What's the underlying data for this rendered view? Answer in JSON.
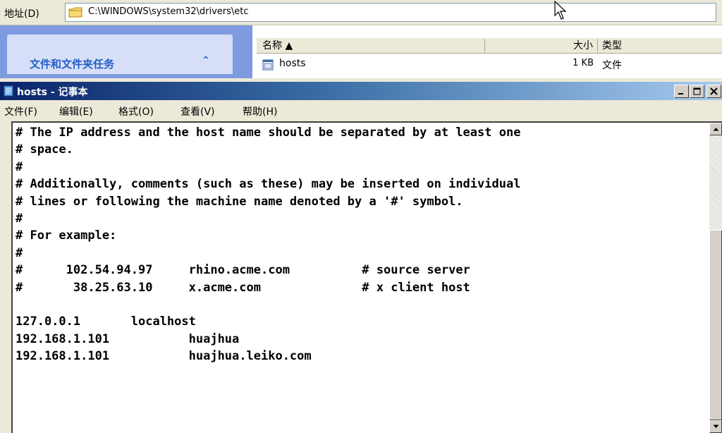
{
  "address_bar": {
    "label": "地址(D)",
    "path": "C:\\WINDOWS\\system32\\drivers\\etc"
  },
  "task_panel": {
    "title": "文件和文件夹任务",
    "collapse_glyph": "⌃"
  },
  "file_list": {
    "columns": {
      "name": "名称 ▲",
      "size": "大小",
      "type": "类型"
    },
    "rows": [
      {
        "name": "hosts",
        "size": "1 KB",
        "type": "文件",
        "icon": "hosts-file-icon"
      }
    ]
  },
  "notepad": {
    "title": "hosts - 记事本",
    "menu": {
      "file": "文件(F)",
      "edit": "编辑(E)",
      "format": "格式(O)",
      "view": "查看(V)",
      "help": "帮助(H)"
    },
    "content": "# The IP address and the host name should be separated by at least one\n# space.\n#\n# Additionally, comments (such as these) may be inserted on individual\n# lines or following the machine name denoted by a '#' symbol.\n#\n# For example:\n#\n#      102.54.94.97     rhino.acme.com          # source server\n#       38.25.63.10     x.acme.com              # x client host\n\n127.0.0.1       localhost\n192.168.1.101           huajhua\n192.168.1.101           huajhua.leiko.com"
  },
  "colors": {
    "titlebar_start": "#0a246a",
    "titlebar_end": "#a6caf0",
    "task_panel_bg": "#7f9be0",
    "task_title": "#215dc6",
    "window_face": "#ece9d8"
  },
  "icons": [
    "folder-icon",
    "mouse-cursor-icon",
    "hosts-file-icon",
    "notepad-icon",
    "minimize-icon",
    "maximize-icon",
    "close-icon",
    "scroll-up-arrow-icon",
    "scroll-down-arrow-icon"
  ]
}
